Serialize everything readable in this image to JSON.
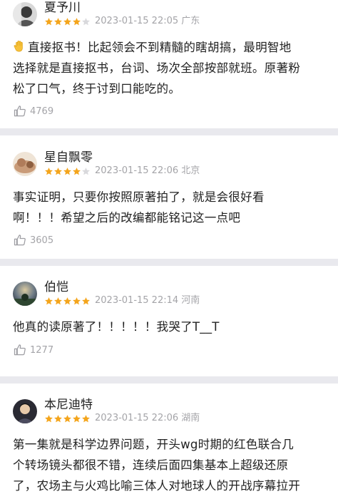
{
  "reviews": [
    {
      "user": "夏予川",
      "rating": 4,
      "max_rating": 5,
      "date": "2023-01-15 22:05",
      "location": "广东",
      "text_lines": [
        "直接抠书！比起领会不到精髓的瞎胡搞，最明智地",
        "选择就是直接抠书，台词、场次全部按部就班。原著粉",
        "松了口气，终于讨到口能吃的。"
      ],
      "likes": "4769"
    },
    {
      "user": "星自飘零",
      "rating": 4,
      "max_rating": 5,
      "date": "2023-01-15 22:06",
      "location": "北京",
      "text_lines": [
        "事实证明，只要你按照原著拍了，就是会很好看",
        "啊！！！希望之后的改编都能铭记这一点吧"
      ],
      "likes": "3605"
    },
    {
      "user": "伯恺",
      "rating": 5,
      "max_rating": 5,
      "date": "2023-01-15 22:14",
      "location": "河南",
      "text_lines": [
        "他真的读原著了！！！！！我哭了T__T"
      ],
      "likes": "1277"
    },
    {
      "user": "本尼迪特",
      "rating": 5,
      "max_rating": 5,
      "date": "2023-01-15 22:06",
      "location": "湖南",
      "text_lines": [
        "第一集就是科学边界问题，开头wg时期的红色联合几",
        "个转场镜头都很不错，连续后面四集基本上超级还原",
        "了，农场主与火鸡比喻三体人对地球人的开战序幕拉开"
      ],
      "likes": ""
    }
  ],
  "colors": {
    "star_filled": "#f4a51c",
    "star_empty": "#d9d9dc",
    "secondary_text": "#a4a4a8",
    "background": "#e9e9ee"
  },
  "icons": {
    "like": "thumbs-up-icon",
    "star": "star-icon",
    "hand": "waving-hand-emoji"
  }
}
